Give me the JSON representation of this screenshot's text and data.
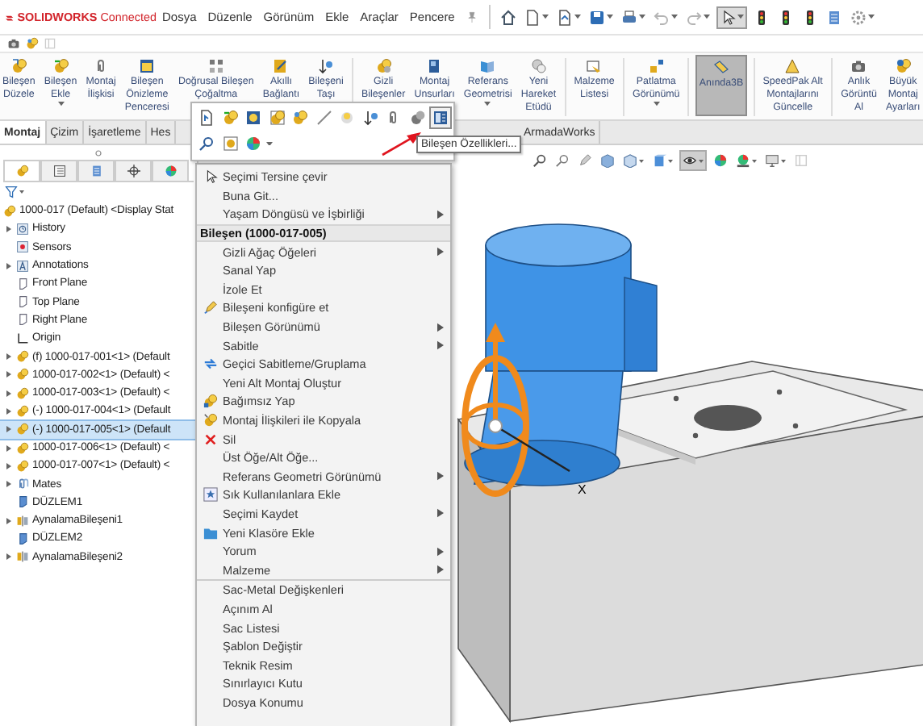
{
  "app_logo": {
    "text": "**SOLIDWORKS** Connected"
  },
  "menu_bar": [
    "Dosya",
    "Düzenle",
    "Görünüm",
    "Ekle",
    "Araçlar",
    "Pencere"
  ],
  "quick_access": [
    {
      "kind": "home",
      "pressed": false,
      "caret": false
    },
    {
      "kind": "new",
      "pressed": false,
      "caret": true
    },
    {
      "kind": "open",
      "pressed": false,
      "caret": true
    },
    {
      "kind": "save",
      "pressed": false,
      "caret": true
    },
    {
      "kind": "print",
      "pressed": false,
      "caret": true
    },
    {
      "kind": "undo",
      "pressed": false,
      "caret": true
    },
    {
      "kind": "redo",
      "pressed": false,
      "caret": true
    },
    {
      "kind": "select",
      "pressed": true,
      "caret": true
    },
    {
      "kind": "traffic",
      "pressed": false,
      "caret": false
    },
    {
      "kind": "traffic",
      "pressed": false,
      "caret": false
    },
    {
      "kind": "traffic",
      "pressed": false,
      "caret": false
    },
    {
      "kind": "file-props",
      "pressed": false,
      "caret": false
    },
    {
      "kind": "options",
      "pressed": false,
      "caret": true
    }
  ],
  "ribbon": [
    {
      "kind": "edit",
      "lines": [
        "Bileşen",
        "Düzele"
      ],
      "caret": false,
      "selected": false
    },
    {
      "kind": "insert",
      "lines": [
        "Bileşen",
        "Ekle"
      ],
      "caret": true,
      "selected": false
    },
    {
      "kind": "mate",
      "lines": [
        "Montaj",
        "İlişkisi"
      ],
      "caret": false,
      "selected": false
    },
    {
      "kind": "preview",
      "lines": [
        "Bileşen",
        "Önizleme",
        "Penceresi"
      ],
      "caret": false,
      "selected": false
    },
    {
      "kind": "pattern",
      "lines": [
        "Doğrusal Bileşen",
        "Çoğaltma"
      ],
      "caret": false,
      "selected": false
    },
    {
      "kind": "smart",
      "lines": [
        "Akıllı",
        "Bağlantı"
      ],
      "caret": false,
      "selected": false
    },
    {
      "kind": "move",
      "lines": [
        "Bileşeni",
        "Taşı"
      ],
      "caret": false,
      "selected": false
    },
    {
      "kind": "hidden",
      "lines": [
        "Gizli",
        "Bileşenler"
      ],
      "caret": false,
      "selected": false
    },
    {
      "kind": "features",
      "lines": [
        "Montaj",
        "Unsurları"
      ],
      "caret": false,
      "selected": false
    },
    {
      "kind": "refgeom",
      "lines": [
        "Referans",
        "Geometrisi"
      ],
      "caret": true,
      "selected": false
    },
    {
      "kind": "motion",
      "lines": [
        "Yeni",
        "Hareket",
        "Etüdü"
      ],
      "caret": false,
      "selected": false
    },
    {
      "kind": "bom",
      "lines": [
        "Malzeme",
        "Listesi"
      ],
      "caret": false,
      "selected": false
    },
    {
      "kind": "explode",
      "lines": [
        "Patlatma",
        "Görünümü"
      ],
      "caret": true,
      "selected": false
    },
    {
      "kind": "instant3d",
      "lines": [
        "Anında3B"
      ],
      "caret": false,
      "selected": true
    },
    {
      "kind": "speedpak",
      "lines": [
        "SpeedPak Alt",
        "Montajlarını",
        "Güncelle"
      ],
      "caret": false,
      "selected": false
    },
    {
      "kind": "snapshot",
      "lines": [
        "Anlık",
        "Görüntü",
        "Al"
      ],
      "caret": false,
      "selected": false
    },
    {
      "kind": "large",
      "lines": [
        "Büyük",
        "Montaj",
        "Ayarları"
      ],
      "caret": false,
      "selected": false
    }
  ],
  "tabs": [
    {
      "label": "Montaj",
      "selected": true
    },
    {
      "label": "Çizim",
      "selected": false
    },
    {
      "label": "İşaretleme",
      "selected": false
    },
    {
      "label": "Hes",
      "selected": false
    }
  ],
  "tabs_right": [
    {
      "label": "ArmadaWorks",
      "selected": false
    }
  ],
  "feature_tree": {
    "panel_tabs": [
      {
        "selected": true
      },
      {
        "selected": false
      },
      {
        "selected": false
      },
      {
        "selected": false
      },
      {
        "selected": false
      }
    ],
    "root": {
      "label": "1000-017 (Default) <Display Stat",
      "children": [
        {
          "kind": "history",
          "label": "History",
          "expander": true,
          "selected": false
        },
        {
          "kind": "sensors",
          "label": "Sensors",
          "expander": false,
          "selected": false
        },
        {
          "kind": "annotations",
          "label": "Annotations",
          "expander": true,
          "selected": false
        },
        {
          "kind": "plane",
          "label": "Front Plane",
          "expander": false,
          "selected": false
        },
        {
          "kind": "plane",
          "label": "Top Plane",
          "expander": false,
          "selected": false
        },
        {
          "kind": "plane",
          "label": "Right Plane",
          "expander": false,
          "selected": false
        },
        {
          "kind": "origin",
          "label": "Origin",
          "expander": false,
          "selected": false
        },
        {
          "kind": "part",
          "label": "(f) 1000-017-001<1> (Default",
          "expander": true,
          "selected": false
        },
        {
          "kind": "part",
          "label": "1000-017-002<1> (Default) <",
          "expander": true,
          "selected": false
        },
        {
          "kind": "part",
          "label": "1000-017-003<1> (Default) <",
          "expander": true,
          "selected": false
        },
        {
          "kind": "part",
          "label": "(-) 1000-017-004<1> (Default",
          "expander": true,
          "selected": false
        },
        {
          "kind": "part",
          "label": "(-) 1000-017-005<1> (Default",
          "expander": true,
          "selected": true
        },
        {
          "kind": "part",
          "label": "1000-017-006<1> (Default) <",
          "expander": true,
          "selected": false
        },
        {
          "kind": "part",
          "label": "1000-017-007<1> (Default) <",
          "expander": true,
          "selected": false
        },
        {
          "kind": "mates",
          "label": "Mates",
          "expander": true,
          "selected": false
        },
        {
          "kind": "mirror-plane",
          "label": "DÜZLEM1",
          "expander": false,
          "selected": false
        },
        {
          "kind": "mirror",
          "label": "AynalamaBileşeni1",
          "expander": true,
          "selected": false
        },
        {
          "kind": "mirror-plane",
          "label": "DÜZLEM2",
          "expander": false,
          "selected": false
        },
        {
          "kind": "mirror",
          "label": "AynalamaBileşeni2",
          "expander": true,
          "selected": false
        }
      ]
    }
  },
  "popup_toolbar": {
    "rows": [
      [
        {
          "kind": "open-doc",
          "hovered": false
        },
        {
          "kind": "insert",
          "hovered": false
        },
        {
          "kind": "edit-comp",
          "hovered": false
        },
        {
          "kind": "edit-asm",
          "hovered": false
        },
        {
          "kind": "comp",
          "hovered": false
        },
        {
          "kind": "sketch",
          "hovered": false
        },
        {
          "kind": "show",
          "hovered": false
        },
        {
          "kind": "move",
          "hovered": false
        },
        {
          "kind": "mate",
          "hovered": false
        },
        {
          "kind": "hide",
          "hovered": false
        },
        {
          "kind": "props",
          "hovered": true
        }
      ],
      [
        {
          "kind": "zoom",
          "hovered": false
        },
        {
          "kind": "isolate",
          "hovered": false
        },
        {
          "kind": "appearance",
          "hovered": false
        }
      ]
    ],
    "tooltip": "Bileşen Özellikleri..."
  },
  "context_menu": {
    "items": [
      {
        "kind": "select",
        "label": "Seçimi Tersine çevir",
        "submenu": false
      },
      {
        "kind": "plain",
        "label": "Buna Git...",
        "submenu": false
      },
      {
        "kind": "plain",
        "label": "Yaşam Döngüsü ve İşbirliği",
        "submenu": true
      },
      {
        "kind": "header",
        "label": "Bileşen (1000-017-005)"
      },
      {
        "kind": "plain",
        "label": "Gizli Ağaç Öğeleri",
        "submenu": true
      },
      {
        "kind": "plain",
        "label": "Sanal Yap",
        "submenu": false
      },
      {
        "kind": "plain",
        "label": "İzole Et",
        "submenu": false
      },
      {
        "kind": "configure",
        "label": "Bileşeni konfigüre et",
        "submenu": false
      },
      {
        "kind": "plain",
        "label": "Bileşen Görünümü",
        "submenu": true
      },
      {
        "kind": "plain",
        "label": "Sabitle",
        "submenu": true
      },
      {
        "kind": "float",
        "label": "Geçici Sabitleme/Gruplama",
        "submenu": false
      },
      {
        "kind": "plain",
        "label": "Yeni Alt Montaj Oluştur",
        "submenu": false
      },
      {
        "kind": "independent",
        "label": "Bağımsız Yap",
        "submenu": false
      },
      {
        "kind": "copy",
        "label": "Montaj İlişkileri ile Kopyala",
        "submenu": false
      },
      {
        "kind": "delete",
        "label": "Sil",
        "submenu": false
      },
      {
        "kind": "plain",
        "label": "Üst Öğe/Alt Öğe...",
        "submenu": false
      },
      {
        "kind": "plain",
        "label": "Referans Geometri Görünümü",
        "submenu": true
      },
      {
        "kind": "favorite",
        "label": "Sık Kullanılanlara Ekle",
        "submenu": false
      },
      {
        "kind": "plain",
        "label": "Seçimi Kaydet",
        "submenu": true
      },
      {
        "kind": "folder",
        "label": "Yeni Klasöre Ekle",
        "submenu": false
      },
      {
        "kind": "plain",
        "label": "Yorum",
        "submenu": true
      },
      {
        "kind": "plain",
        "label": "Malzeme",
        "submenu": true
      },
      {
        "kind": "separator"
      },
      {
        "kind": "plain",
        "label": "Sac-Metal Değişkenleri",
        "submenu": false
      },
      {
        "kind": "plain",
        "label": "Açınım Al",
        "submenu": false
      },
      {
        "kind": "plain",
        "label": "Sac Listesi",
        "submenu": false
      },
      {
        "kind": "plain",
        "label": "Şablon Değiştir",
        "submenu": false
      },
      {
        "kind": "plain",
        "label": "Teknik Resim",
        "submenu": false
      },
      {
        "kind": "plain",
        "label": "Sınırlayıcı Kutu",
        "submenu": false
      },
      {
        "kind": "plain",
        "label": "Dosya Konumu",
        "submenu": false
      }
    ]
  },
  "view_toolbar": [
    {
      "kind": "zoom-fit",
      "pressed": false,
      "caret": false
    },
    {
      "kind": "zoom-area",
      "pressed": false,
      "caret": false
    },
    {
      "kind": "prev-view",
      "pressed": false,
      "caret": false
    },
    {
      "kind": "section",
      "pressed": false,
      "caret": false
    },
    {
      "kind": "orient",
      "pressed": false,
      "caret": true
    },
    {
      "kind": "display-style",
      "pressed": false,
      "caret": true
    },
    {
      "kind": "hide-show",
      "pressed": true,
      "caret": true
    },
    {
      "kind": "appearance",
      "pressed": false,
      "caret": false
    },
    {
      "kind": "scene",
      "pressed": false,
      "caret": true
    },
    {
      "kind": "monitor",
      "pressed": false,
      "caret": true
    },
    {
      "kind": "faded",
      "pressed": false,
      "caret": false
    }
  ],
  "viewport": {
    "triad_label": "X"
  }
}
